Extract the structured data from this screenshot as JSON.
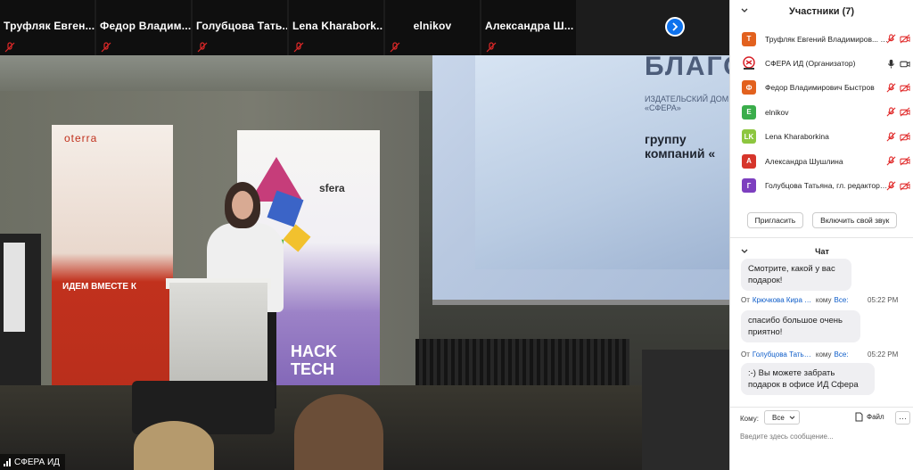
{
  "strip": {
    "tiles": [
      {
        "name": "Труфляк  Евген..."
      },
      {
        "name": "Федор  Владим..."
      },
      {
        "name": "Голубцова  Тать..."
      },
      {
        "name": "Lena  Kharabork..."
      },
      {
        "name": "elnikov"
      },
      {
        "name": "Александра  Ш..."
      }
    ]
  },
  "video": {
    "self_label": "СФЕРА ИД",
    "slide": {
      "title": "БЛАГОД",
      "publisher": "ИЗДАТЕЛЬСКИЙ ДОМ «СФЕРА»",
      "big": "группу компаний «"
    },
    "banner_left": {
      "logo": "oterra",
      "text": "ИДЕМ ВМЕСТЕ К"
    },
    "banner_right": {
      "logo": "sfera",
      "text": "HACK TECH"
    }
  },
  "participants": {
    "header": "Участники (7)",
    "list": [
      {
        "name": "Труфляк Евгений Владимиров... (Я)",
        "initial": "Т",
        "color": "#e2611e"
      },
      {
        "name": "СФЕРА ИД (Организатор)",
        "initial": "",
        "color": "#ffffff"
      },
      {
        "name": "Федор Владимирович Быстров",
        "initial": "Ф",
        "color": "#e2611e"
      },
      {
        "name": "elnikov",
        "initial": "E",
        "color": "#3aad4b"
      },
      {
        "name": "Lena Kharaborkina",
        "initial": "LK",
        "color": "#8dc63f"
      },
      {
        "name": "Александра Шушлина",
        "initial": "А",
        "color": "#d6352b"
      },
      {
        "name": "Голубцова Татьяна, гл. редактор ...",
        "initial": "Г",
        "color": "#7d3fbf"
      }
    ],
    "invite_label": "Пригласить",
    "unmute_label": "Включить свой звук"
  },
  "chat": {
    "header": "Чат",
    "messages": [
      {
        "text": "Смотрите, какой у вас подарок!"
      },
      {
        "from_prefix": "От",
        "from": "Крючкова Кира Викто...",
        "to_prefix": "кому",
        "to": "Все:",
        "time": "05:22 PM",
        "text": "спасибо большое очень приятно!"
      },
      {
        "from_prefix": "От",
        "from": "Голубцова Татьяна, гл. ...",
        "to_prefix": "кому",
        "to": "Все:",
        "time": "05:22 PM",
        "text": ":-) Вы можете забрать подарок в офисе ИД Сфера"
      }
    ],
    "to_label": "Кому:",
    "to_value": "Все",
    "file_label": "Файл",
    "more_label": "···",
    "input_placeholder": "Введите здесь сообщение..."
  },
  "colors": {
    "accent": "#0e72ed",
    "muted": "#e02828"
  }
}
